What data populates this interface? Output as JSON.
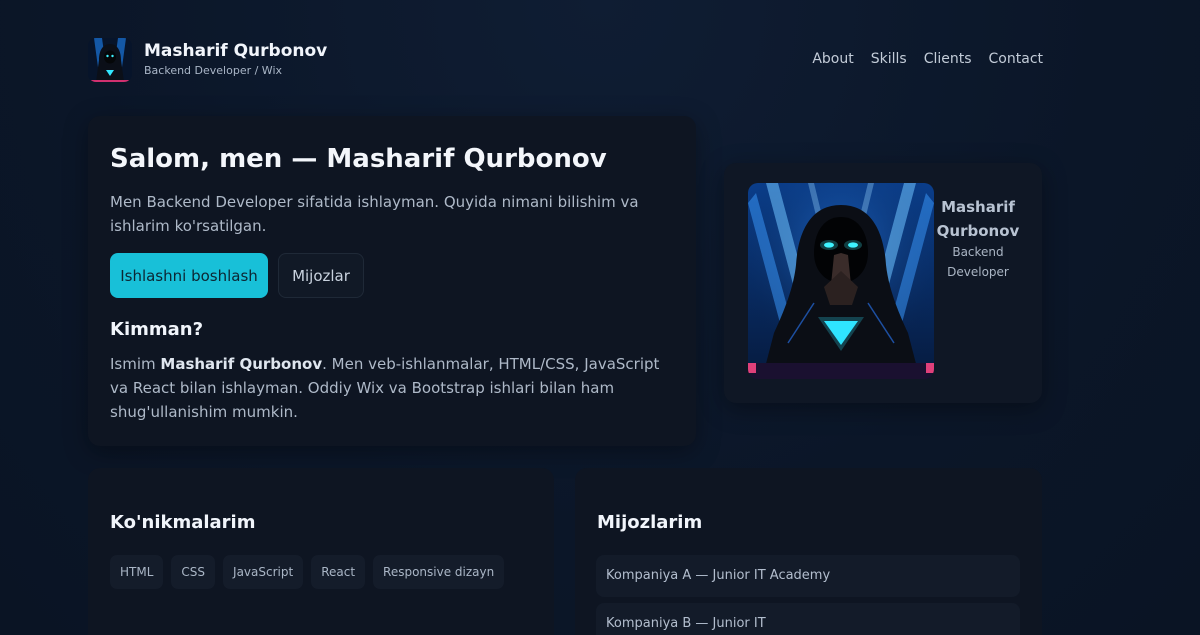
{
  "brand": {
    "name": "Masharif Qurbonov",
    "role": "Backend Developer / Wix"
  },
  "nav": {
    "items": [
      "About",
      "Skills",
      "Clients",
      "Contact"
    ]
  },
  "hero": {
    "title": "Salom, men — Masharif Qurbonov",
    "description": "Men Backend Developer sifatida ishlayman. Quyida nimani bilishim va ishlarim ko'rsatilgan.",
    "primary_button": "Ishlashni boshlash",
    "secondary_button": "Mijozlar",
    "who_title": "Kimman?",
    "who_prefix": "Ismim ",
    "who_name": "Masharif Qurbonov",
    "who_suffix": ". Men veb-ishlanmalar, HTML/CSS, JavaScript va React bilan ishlayman. Oddiy Wix va Bootstrap ishlari bilan ham shug'ullanishim mumkin."
  },
  "profile": {
    "name": "Masharif Qurbonov",
    "role": "Backend Developer"
  },
  "skills": {
    "title": "Ko'nikmalarim",
    "items": [
      "HTML",
      "CSS",
      "JavaScript",
      "React",
      "Responsive dizayn"
    ]
  },
  "clients": {
    "title": "Mijozlarim",
    "items": [
      "Kompaniya A — Junior IT Academy",
      "Kompaniya B — Junior IT"
    ]
  },
  "colors": {
    "accent": "#18c0d8",
    "background": "#0b1628",
    "card": "#0e1522"
  }
}
